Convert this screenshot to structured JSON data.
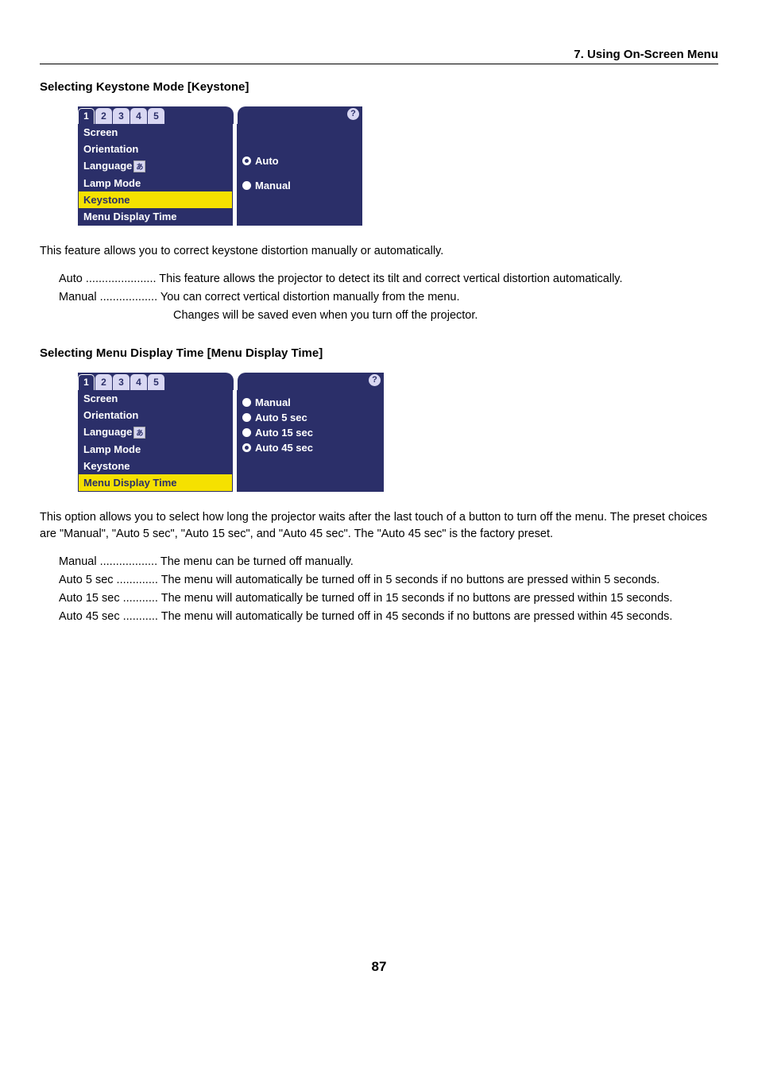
{
  "chapter": "7. Using On-Screen Menu",
  "section1": {
    "title": "Selecting Keystone Mode [Keystone]",
    "tabs": [
      "1",
      "2",
      "3",
      "4",
      "5"
    ],
    "menu_items": [
      "Screen",
      "Orientation",
      "Language",
      "Lamp Mode",
      "Keystone",
      "Menu Display Time"
    ],
    "highlight_index": 4,
    "options": [
      {
        "label": "Auto",
        "selected": true
      },
      {
        "label": "Manual",
        "selected": false
      }
    ],
    "body": "This feature allows you to correct keystone distortion manually or automatically.",
    "defs": [
      {
        "term": "Auto",
        "dots": "......................",
        "desc": "This feature allows the projector to detect its tilt and correct vertical distortion automatically."
      },
      {
        "term": "Manual",
        "dots": "..................",
        "desc": "You can correct vertical distortion manually from the menu."
      }
    ],
    "note": "Changes will be saved even when you turn off the projector."
  },
  "section2": {
    "title": "Selecting Menu Display Time [Menu Display Time]",
    "tabs": [
      "1",
      "2",
      "3",
      "4",
      "5"
    ],
    "menu_items": [
      "Screen",
      "Orientation",
      "Language",
      "Lamp Mode",
      "Keystone",
      "Menu Display Time"
    ],
    "highlight_index": 5,
    "options": [
      {
        "label": "Manual",
        "selected": false
      },
      {
        "label": "Auto  5 sec",
        "selected": false
      },
      {
        "label": "Auto 15 sec",
        "selected": false
      },
      {
        "label": "Auto 45 sec",
        "selected": true
      }
    ],
    "body": "This option allows you to select how long the projector waits after the last touch of a button to turn off the menu. The preset choices are \"Manual\", \"Auto 5 sec\", \"Auto 15 sec\", and \"Auto 45 sec\". The \"Auto 45 sec\" is the factory preset.",
    "defs": [
      {
        "term": "Manual",
        "dots": "..................",
        "desc": "The menu can be turned off manually."
      },
      {
        "term": "Auto 5 sec",
        "dots": ".............",
        "desc": "The menu will automatically be turned off in 5 seconds if no buttons are pressed within 5 seconds."
      },
      {
        "term": "Auto 15 sec",
        "dots": "...........",
        "desc": "The menu will automatically be turned off in 15 seconds if no buttons are pressed within 15 seconds."
      },
      {
        "term": "Auto 45 sec",
        "dots": "...........",
        "desc": "The menu will automatically be turned off in 45 seconds if no buttons are pressed within 45 seconds."
      }
    ]
  },
  "page_number": "87"
}
